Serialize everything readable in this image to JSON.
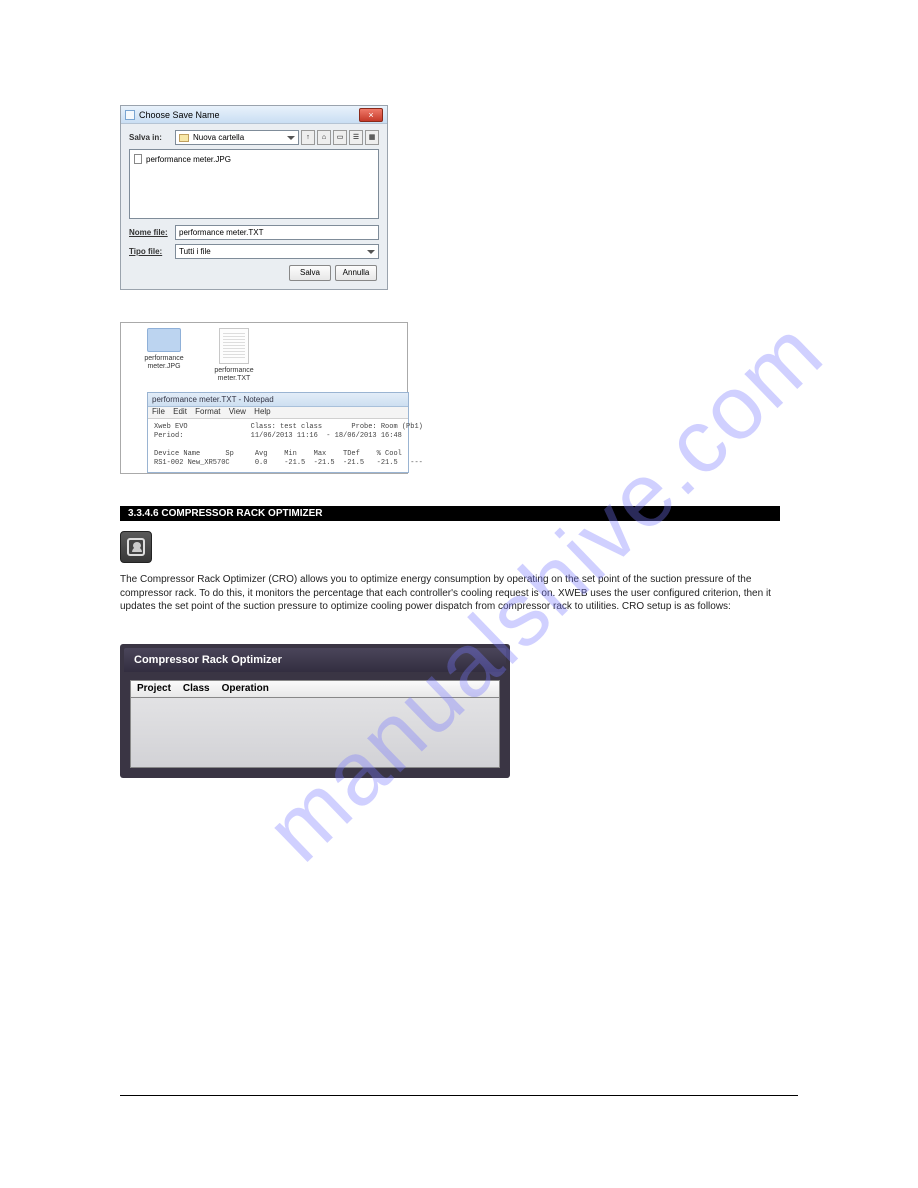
{
  "watermark": "manualshive.com",
  "save_dialog": {
    "title": "Choose Save Name",
    "save_in_label": "Salva in:",
    "folder": "Nuova cartella",
    "file_in_list": "performance meter.JPG",
    "name_label": "Nome file:",
    "name_value": "performance meter.TXT",
    "type_label": "Tipo file:",
    "type_value": "Tutti i file",
    "save_btn": "Salva",
    "cancel_btn": "Annulla",
    "close_x": "×"
  },
  "explorer": {
    "jpg_label": "performance\nmeter.JPG",
    "txt_label": "performance\nmeter.TXT"
  },
  "notepad": {
    "title": "performance meter.TXT - Notepad",
    "menu": [
      "File",
      "Edit",
      "Format",
      "View",
      "Help"
    ],
    "content": "Xweb EVO               Class: test class       Probe: Room (Pb1)\nPeriod:                11/06/2013 11:16  - 18/06/2013 16:48\n\nDevice Name      Sp     Avg    Min    Max    TDef    % Cool\nRS1-002 New_XR570C      0.0    -21.5  -21.5  -21.5   -21.5   ---"
  },
  "section_bar": "3.3.4.6 COMPRESSOR RACK OPTIMIZER",
  "body_text": "The Compressor Rack Optimizer (CRO) allows you to optimize energy consumption by operating on the set point of the suction pressure of the compressor rack. To do this, it monitors the percentage that each controller's cooling request is on. XWEB uses the user configured criterion, then it updates the set point of the suction pressure to optimize cooling power dispatch from compressor rack to utilities. CRO setup is as follows:",
  "cro_window": {
    "title": "Compressor Rack Optimizer",
    "menu": [
      "Project",
      "Class",
      "Operation"
    ]
  }
}
